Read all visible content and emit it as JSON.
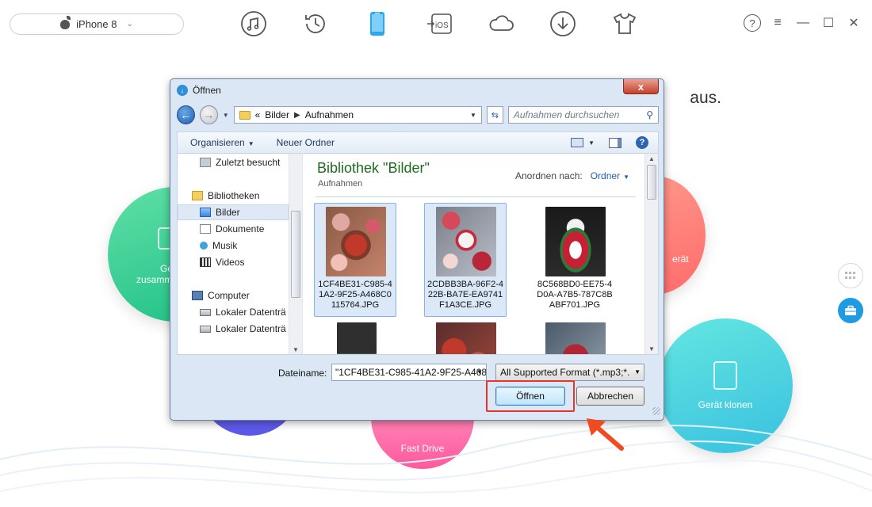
{
  "app": {
    "device_name": "iPhone 8",
    "prompt": "aus.",
    "toolbar_icons": [
      "music-icon",
      "history-icon",
      "device-icon",
      "ios-icon",
      "cloud-icon",
      "download-icon",
      "tshirt-icon"
    ],
    "toolbar_ios_label": "iOS",
    "accent": "#1e9be3"
  },
  "features": {
    "green_label_1": "Ge",
    "green_label_2": "zusamm",
    "red_label": "erät",
    "pink_label": "Fast Drive",
    "cyan_label": "Gerät klonen"
  },
  "dialog": {
    "title": "Öffnen",
    "close_label": "x",
    "breadcrumb": [
      "Bilder",
      "Aufnahmen"
    ],
    "breadcrumb_prefix": "«",
    "search_placeholder": "Aufnahmen durchsuchen",
    "commands": {
      "organize": "Organisieren",
      "new_folder": "Neuer Ordner"
    },
    "nav_items": {
      "recent": "Zuletzt besucht",
      "libraries": "Bibliotheken",
      "pictures": "Bilder",
      "documents": "Dokumente",
      "music": "Musik",
      "videos": "Videos",
      "computer": "Computer",
      "drive1": "Lokaler Datenträ",
      "drive2": "Lokaler Datenträ"
    },
    "library_title": "Bibliothek \"Bilder\"",
    "library_subtitle": "Aufnahmen",
    "arrange_label": "Anordnen nach:",
    "arrange_value": "Ordner",
    "files": [
      {
        "name": "1CF4BE31-C985-41A2-9F25-A468C0115764.JPG",
        "selected": true
      },
      {
        "name": "2CDBB3BA-96F2-422B-BA7E-EA9741F1A3CE.JPG",
        "selected": true
      },
      {
        "name": "8C568BD0-EE75-4D0A-A7B5-787C8BABF701.JPG",
        "selected": false
      }
    ],
    "filename_label": "Dateiname:",
    "filename_value": "\"1CF4BE31-C985-41A2-9F25-A468",
    "filter_value": "All Supported Format (*.mp3;*.",
    "open_label": "Öffnen",
    "cancel_label": "Abbrechen",
    "highlight_color": "#e8352a"
  }
}
